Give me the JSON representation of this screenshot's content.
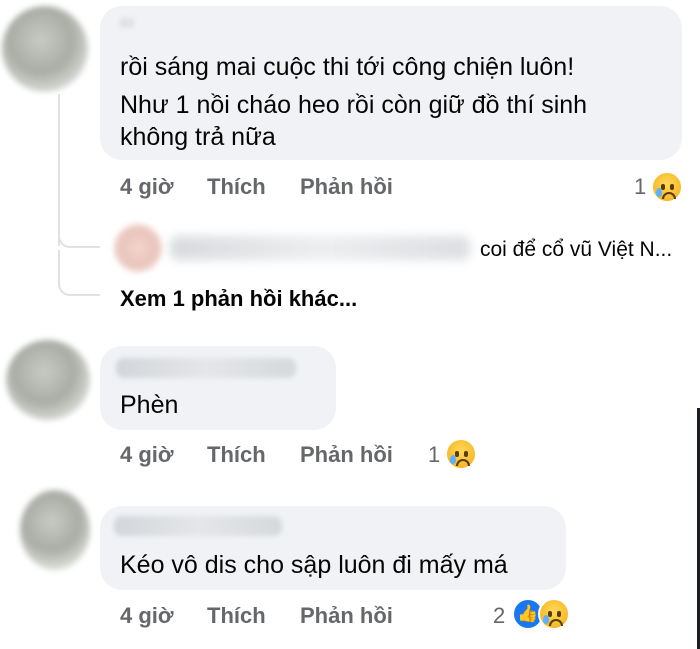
{
  "comments": [
    {
      "lines": [
        "rồi sáng mai cuộc thi tới công chiện luôn!",
        "Như 1 nồi cháo heo rồi còn giữ đồ thí sinh",
        "không trả nữa"
      ],
      "time": "4 giờ",
      "like_label": "Thích",
      "reply_label": "Phản hồi",
      "reaction_count": "1",
      "reactions": [
        "sad"
      ]
    },
    {
      "lines": [
        "Phèn"
      ],
      "time": "4 giờ",
      "like_label": "Thích",
      "reply_label": "Phản hồi",
      "reaction_count": "1",
      "reactions": [
        "sad"
      ]
    },
    {
      "lines": [
        "Kéo vô dis cho sập luôn đi mấy má"
      ],
      "time": "4 giờ",
      "like_label": "Thích",
      "reply_label": "Phản hồi",
      "reaction_count": "2",
      "reactions": [
        "like",
        "sad"
      ]
    }
  ],
  "reply_preview": {
    "text": "coi để cổ vũ Việt N..."
  },
  "more_replies_label": "Xem 1 phản hồi khác...",
  "colors": {
    "bubble": "#f0f2f5",
    "secondary_text": "#65676b",
    "like_blue": "#1877f2"
  }
}
